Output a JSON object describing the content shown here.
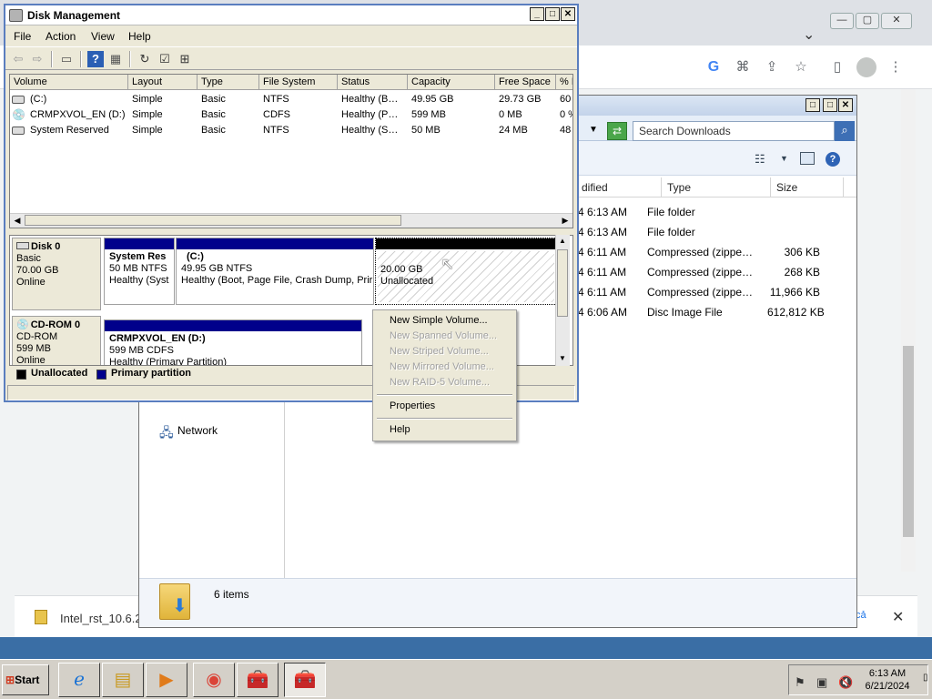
{
  "chrome": {
    "window_controls": [
      "—",
      "▢",
      "✕"
    ],
    "chevron": "⌄",
    "icons": [
      "google-icon",
      "translate-icon",
      "share-icon",
      "bookmark-star-icon",
      "side-panel-icon",
      "profile-avatar-icon",
      "more-menu-icon"
    ],
    "download": {
      "filename": "Intel_rst_10.6.2",
      "show_all_fragment": "cả",
      "close": "✕"
    }
  },
  "explorer": {
    "search_placeholder": "Search Downloads",
    "columns": [
      "dified",
      "Type",
      "Size"
    ],
    "rows": [
      {
        "modified": "4 6:13 AM",
        "type": "File folder",
        "size": ""
      },
      {
        "modified": "4 6:13 AM",
        "type": "File folder",
        "size": ""
      },
      {
        "modified": "4 6:11 AM",
        "type": "Compressed (zippe…",
        "size": "306 KB"
      },
      {
        "modified": "4 6:11 AM",
        "type": "Compressed (zippe…",
        "size": "268 KB"
      },
      {
        "modified": "4 6:11 AM",
        "type": "Compressed (zippe…",
        "size": "11,966 KB"
      },
      {
        "modified": "4 6:06 AM",
        "type": "Disc Image File",
        "size": "612,812 KB"
      }
    ],
    "nav_network": "Network",
    "item_count": "6 items"
  },
  "disk_mgmt": {
    "title": "Disk Management",
    "caption_buttons": [
      "_",
      "□",
      "✕"
    ],
    "menu": [
      "File",
      "Action",
      "View",
      "Help"
    ],
    "toolbar_icons": [
      "back-icon",
      "forward-icon",
      "up-icon",
      "help-icon",
      "view-icon",
      "refresh-icon",
      "properties-icon",
      "rescan-icon"
    ],
    "columns": [
      "Volume",
      "Layout",
      "Type",
      "File System",
      "Status",
      "Capacity",
      "Free Space",
      "% F"
    ],
    "volumes": [
      {
        "volume": "(C:)",
        "layout": "Simple",
        "type": "Basic",
        "fs": "NTFS",
        "status": "Healthy (B…",
        "capacity": "49.95 GB",
        "free": "29.73 GB",
        "pct": "60"
      },
      {
        "volume": "CRMPXVOL_EN (D:)",
        "layout": "Simple",
        "type": "Basic",
        "fs": "CDFS",
        "status": "Healthy (P…",
        "capacity": "599 MB",
        "free": "0 MB",
        "pct": "0 %"
      },
      {
        "volume": "System Reserved",
        "layout": "Simple",
        "type": "Basic",
        "fs": "NTFS",
        "status": "Healthy (S…",
        "capacity": "50 MB",
        "free": "24 MB",
        "pct": "48"
      }
    ],
    "disk0": {
      "name": "Disk 0",
      "type": "Basic",
      "size": "70.00 GB",
      "state": "Online",
      "parts": [
        {
          "name": "System Res",
          "line1": "50 MB NTFS",
          "line2": "Healthy (Syst"
        },
        {
          "name": "(C:)",
          "line1": "49.95 GB NTFS",
          "line2": "Healthy (Boot, Page File, Crash Dump, Prir"
        },
        {
          "name": "",
          "line1": "20.00 GB",
          "line2": "Unallocated"
        }
      ]
    },
    "cdrom0": {
      "name": "CD-ROM 0",
      "type": "CD-ROM",
      "size": "599 MB",
      "state": "Online",
      "part": {
        "name": "CRMPXVOL_EN  (D:)",
        "line1": "599 MB CDFS",
        "line2": "Healthy (Primary Partition)"
      }
    },
    "legend": {
      "unallocated": "Unallocated",
      "primary": "Primary partition"
    },
    "context_menu": {
      "items": [
        {
          "label": "New Simple Volume...",
          "enabled": true
        },
        {
          "label": "New Spanned Volume...",
          "enabled": false
        },
        {
          "label": "New Striped Volume...",
          "enabled": false
        },
        {
          "label": "New Mirrored Volume...",
          "enabled": false
        },
        {
          "label": "New RAID-5 Volume...",
          "enabled": false
        },
        {
          "label": "Properties",
          "enabled": true
        },
        {
          "label": "Help",
          "enabled": true
        }
      ]
    }
  },
  "taskbar": {
    "start": "Start",
    "time": "6:13 AM",
    "date": "6/21/2024"
  }
}
